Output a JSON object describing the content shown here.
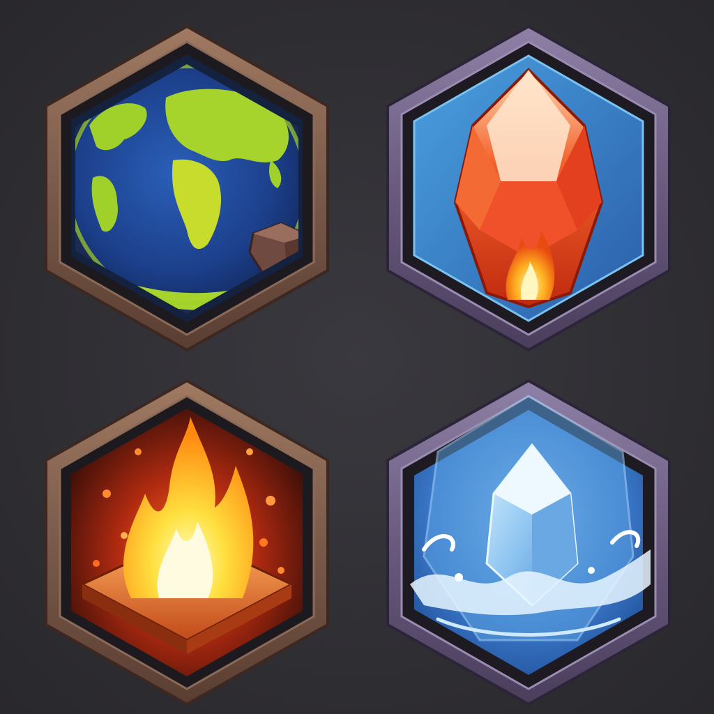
{
  "icons": [
    {
      "element": "earth",
      "icon": "earth-globe-icon",
      "frame_color": "#7a5a4a",
      "accent": "#8fcb2a"
    },
    {
      "element": "fire-gem",
      "icon": "fire-gem-icon",
      "frame_color": "#6a5a7e",
      "accent": "#f04a1e"
    },
    {
      "element": "fire",
      "icon": "flame-icon",
      "frame_color": "#7a5a4a",
      "accent": "#ffcc33"
    },
    {
      "element": "water",
      "icon": "water-crystal-icon",
      "frame_color": "#6a5a7e",
      "accent": "#4a8fd8"
    }
  ],
  "colors": {
    "background": "#2f2e33",
    "brown_frame": "#7a5a4a",
    "purple_frame": "#6a5a7e"
  }
}
